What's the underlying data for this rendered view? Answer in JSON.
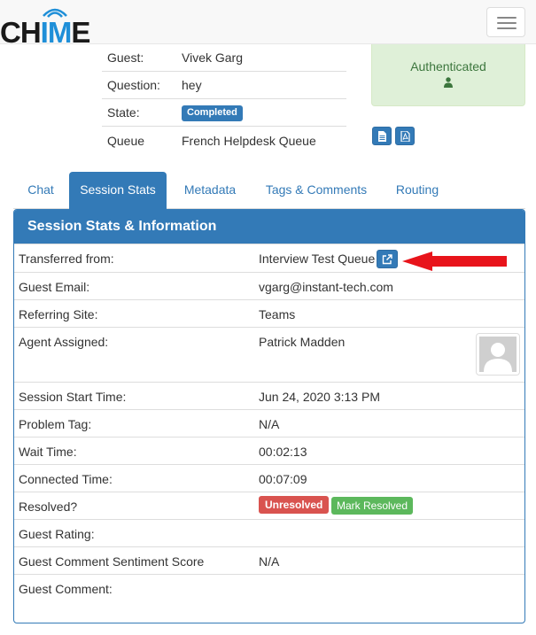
{
  "brand": {
    "logo_text_dark_1": "CH",
    "logo_text_blue": "IM",
    "logo_text_dark_2": "E"
  },
  "navbar": {
    "toggle_icon": "hamburger-icon"
  },
  "session_info": {
    "rows": [
      {
        "label": "Guest:",
        "value": "Vivek Garg"
      },
      {
        "label": "Question:",
        "value": "hey"
      },
      {
        "label": "State:",
        "value": "Completed"
      },
      {
        "label": "Queue",
        "value": "French Helpdesk Queue"
      }
    ]
  },
  "auth_status": {
    "text": "Authenticated",
    "icon": "user-icon"
  },
  "export_buttons": [
    {
      "icon": "file-text-icon"
    },
    {
      "icon": "file-pdf-icon"
    }
  ],
  "tabs": [
    {
      "label": "Chat",
      "active": false
    },
    {
      "label": "Session Stats",
      "active": true
    },
    {
      "label": "Metadata",
      "active": false
    },
    {
      "label": "Tags & Comments",
      "active": false
    },
    {
      "label": "Routing",
      "active": false
    }
  ],
  "panel": {
    "title": "Session Stats & Information",
    "rows": [
      {
        "label": "Transferred from:",
        "value": "Interview Test Queue"
      },
      {
        "label": "Guest Email:",
        "value": "vgarg@instant-tech.com"
      },
      {
        "label": "Referring Site:",
        "value": "Teams"
      },
      {
        "label": "Agent Assigned:",
        "value": "Patrick Madden"
      },
      {
        "label": "Session Start Time:",
        "value": "Jun 24, 2020 3:13 PM"
      },
      {
        "label": "Problem Tag:",
        "value": "N/A"
      },
      {
        "label": "Wait Time:",
        "value": "00:02:13"
      },
      {
        "label": "Connected Time:",
        "value": "00:07:09"
      },
      {
        "label": "Resolved?",
        "value": ""
      },
      {
        "label": "Guest Rating:",
        "value": ""
      },
      {
        "label": "Guest Comment Sentiment Score",
        "value": "N/A"
      },
      {
        "label": "Guest Comment:",
        "value": ""
      }
    ],
    "unresolved_label": "Unresolved",
    "mark_resolved_label": "Mark Resolved"
  },
  "colors": {
    "primary": "#337ab7",
    "success_bg": "#dff0d8",
    "success_text": "#3c763d",
    "danger": "#d9534f",
    "success_btn": "#5cb85c",
    "annotation_arrow": "#e8141b"
  }
}
